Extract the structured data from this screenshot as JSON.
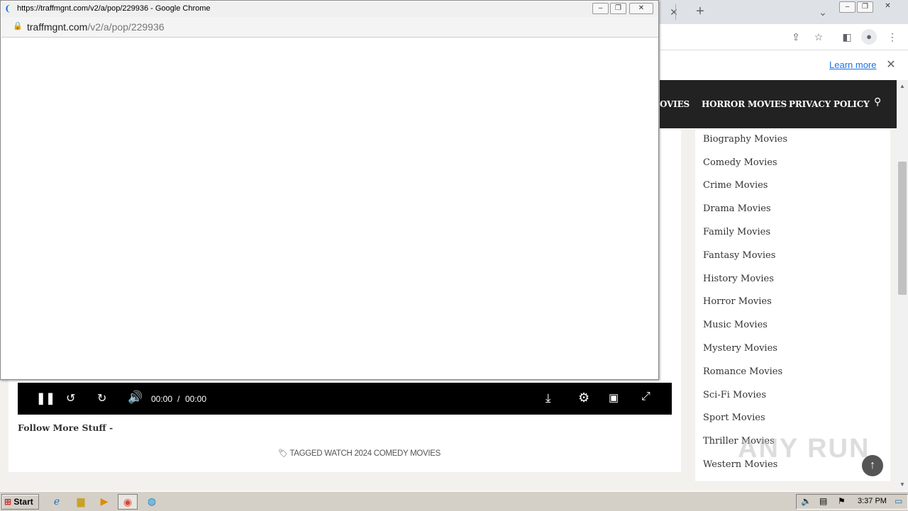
{
  "popup": {
    "title": "https://traffmgnt.com/v2/a/pop/229936 - Google Chrome",
    "url_domain": "traffmgnt.com",
    "url_path": "/v2/a/pop/229936"
  },
  "browser": {
    "learn_more": "Learn more"
  },
  "nav": {
    "items": [
      "OVIES",
      "HORROR MOVIES",
      "PRIVACY POLICY"
    ]
  },
  "video": {
    "current_time": "00:00",
    "separator": "/",
    "duration": "00:00"
  },
  "article": {
    "follow_text": "Follow More Stuff -",
    "tagged_prefix": "TAGGED",
    "tag": "WATCH 2024 COMEDY MOVIES"
  },
  "sidebar": {
    "items": [
      "Biography Movies",
      "Comedy Movies",
      "Crime Movies",
      "Drama Movies",
      "Family Movies",
      "Fantasy Movies",
      "History Movies",
      "Horror Movies",
      "Music Movies",
      "Mystery Movies",
      "Romance Movies",
      "Sci-Fi Movies",
      "Sport Movies",
      "Thriller Movies",
      "Western Movies"
    ]
  },
  "watermark": "ANY RUN",
  "taskbar": {
    "start_label": "Start",
    "clock": "3:37 PM"
  }
}
